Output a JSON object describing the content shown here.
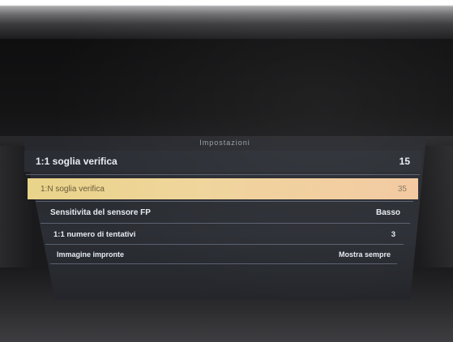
{
  "screen": {
    "title": "Impostazioni",
    "rows": [
      {
        "label": "1:1 soglia verifica",
        "value": "15",
        "selected": false
      },
      {
        "label": "1:N soglia verifica",
        "value": "35",
        "selected": true
      },
      {
        "label": "Sensitivita del sensore FP",
        "value": "Basso",
        "selected": false
      },
      {
        "label": "1:1 numero di tentativi",
        "value": "3",
        "selected": false
      },
      {
        "label": "Immagine impronte",
        "value": "Mostra sempre",
        "selected": false
      }
    ]
  },
  "colors": {
    "selected_row": "#f0d49a",
    "row_text": "#e8ecf2",
    "screen_bg": "#2b2e34"
  }
}
